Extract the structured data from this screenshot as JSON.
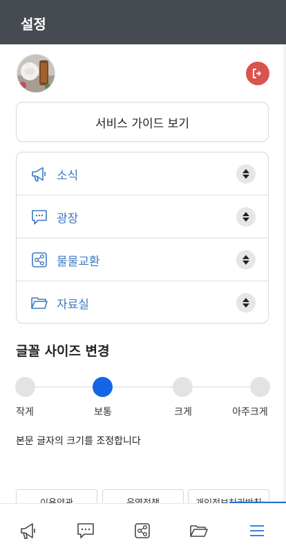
{
  "header": {
    "title": "설정"
  },
  "profile": {
    "avatar_alt": "profile-photo"
  },
  "guide_button": {
    "label": "서비스 가이드 보기"
  },
  "menu": {
    "items": [
      {
        "label": "소식",
        "icon": "megaphone-icon"
      },
      {
        "label": "광장",
        "icon": "chat-bubble-icon"
      },
      {
        "label": "물물교환",
        "icon": "share-icon"
      },
      {
        "label": "자료실",
        "icon": "folder-icon"
      }
    ]
  },
  "font_size": {
    "title": "글꼴 사이즈 변경",
    "options": [
      "작게",
      "보통",
      "크게",
      "아주크게"
    ],
    "selected": "보통",
    "description": "본문 글자의 크기를 조정합니다"
  },
  "footer_links": [
    "이용약관",
    "운영정책",
    "개인정보처리방침"
  ],
  "bottom_nav": {
    "items": [
      "megaphone-icon",
      "chat-bubble-icon",
      "share-icon",
      "folder-icon",
      "menu-icon"
    ],
    "active": "menu-icon"
  },
  "colors": {
    "header_bg": "#454b51",
    "accent": "#1565e6",
    "menu_text": "#3a78c4",
    "logout": "#d9534f"
  }
}
